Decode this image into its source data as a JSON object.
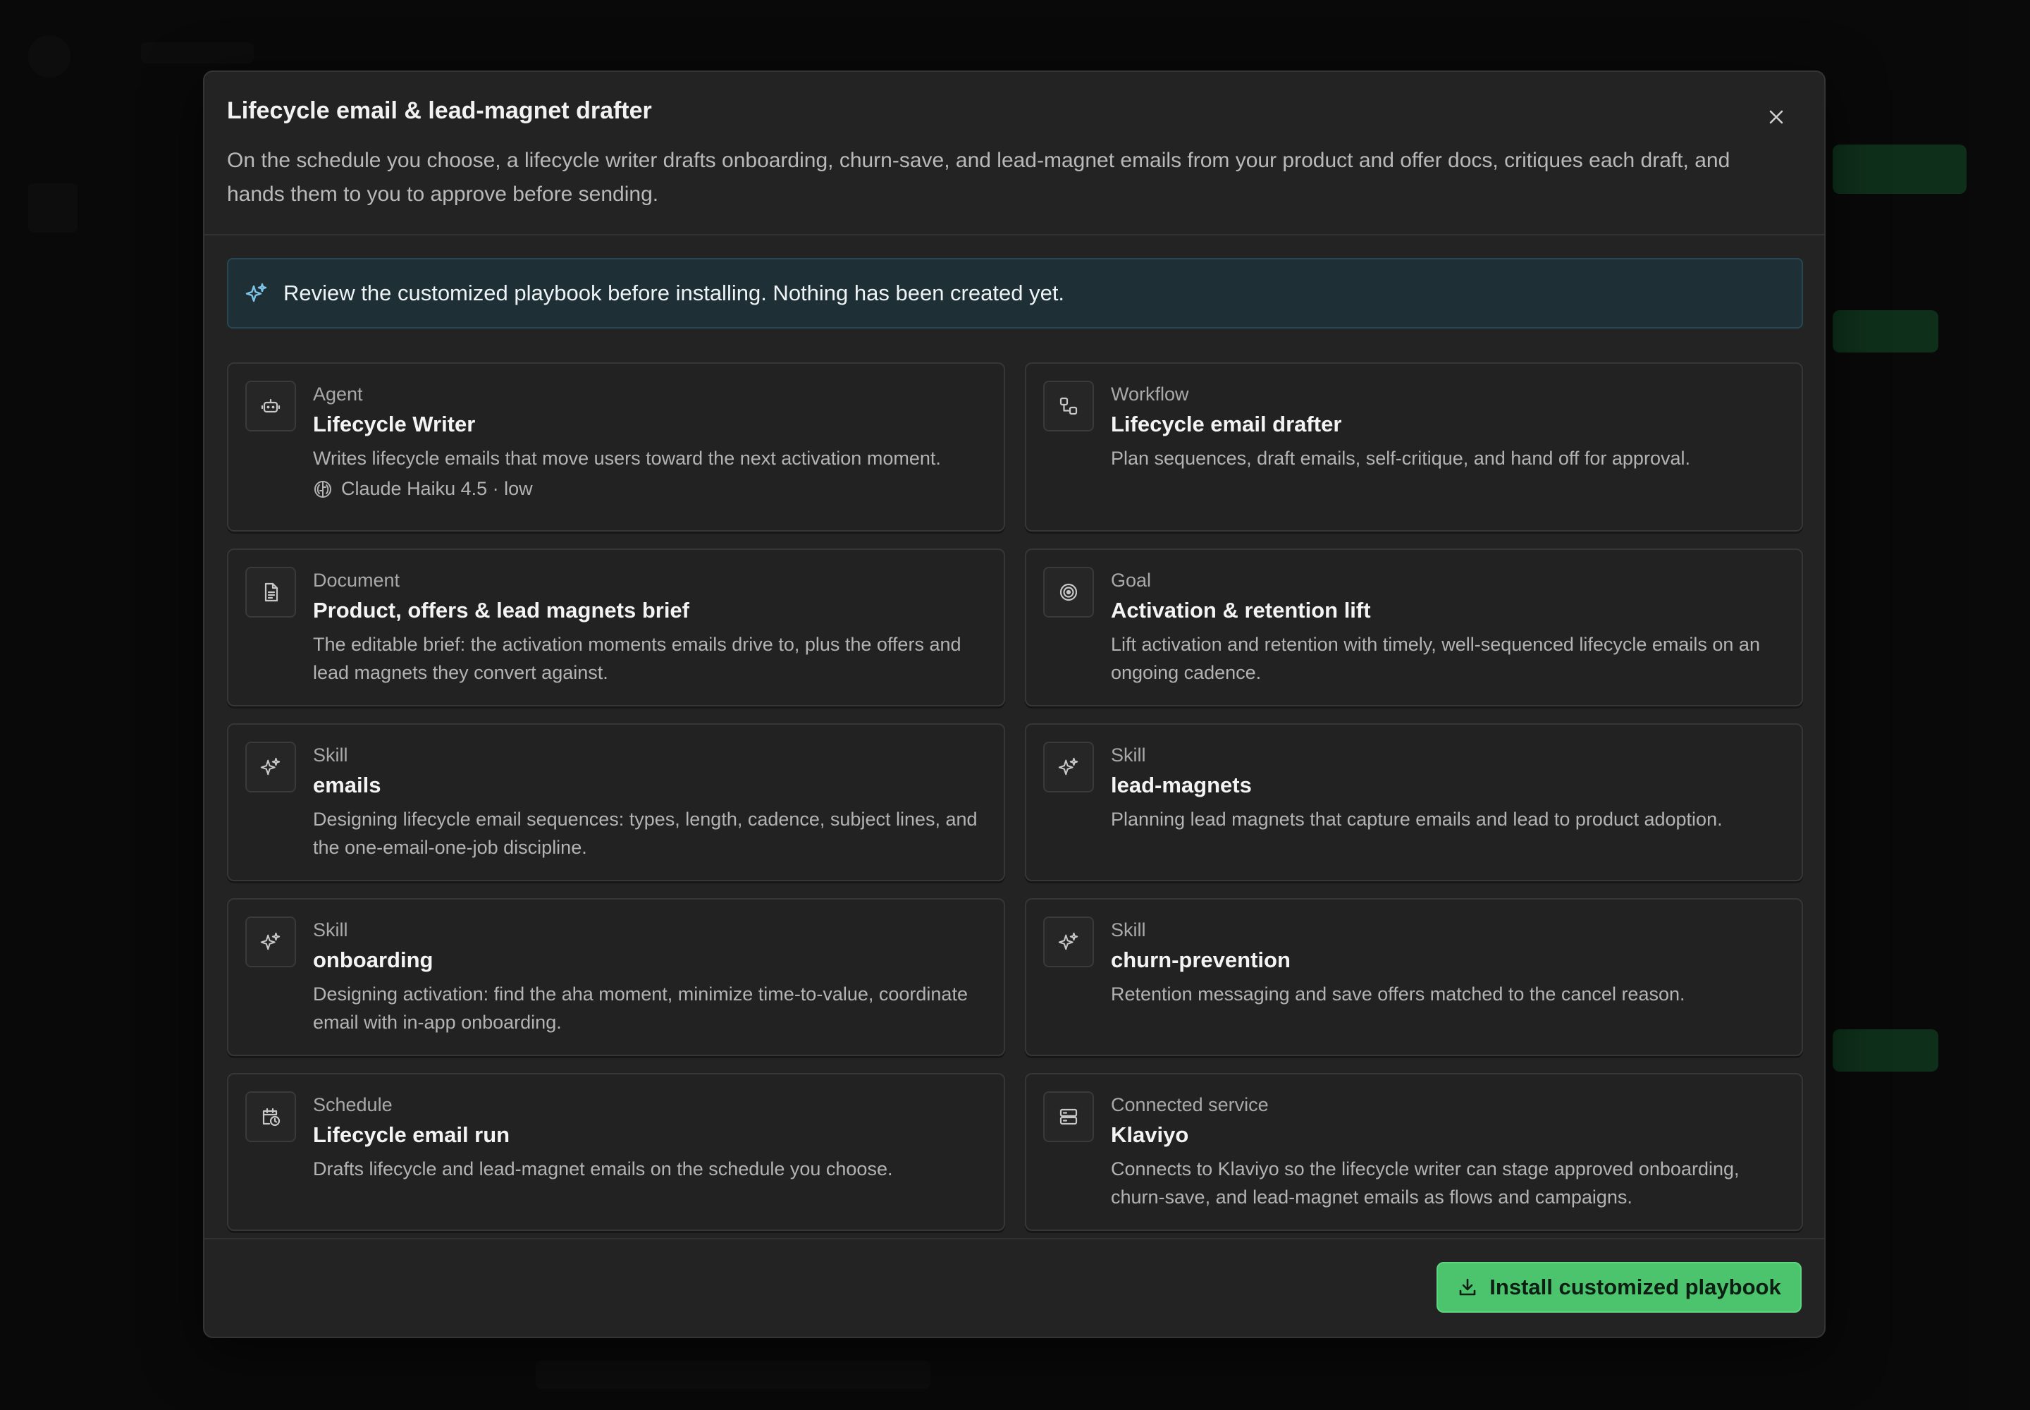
{
  "modal": {
    "title": "Lifecycle email & lead-magnet drafter",
    "description": "On the schedule you choose, a lifecycle writer drafts onboarding, churn-save, and lead-magnet emails from your product and offer docs, critiques each draft, and hands them to you to approve before sending.",
    "close_icon": "close-icon"
  },
  "banner": {
    "icon": "sparkle-icon",
    "text": "Review the customized playbook before installing. Nothing has been created yet."
  },
  "cards": [
    {
      "kind": "Agent",
      "title": "Lifecycle Writer",
      "description": "Writes lifecycle emails that move users toward the next activation moment.",
      "icon": "robot-icon",
      "model": "Claude Haiku 4.5 · low",
      "model_icon": "brain-icon"
    },
    {
      "kind": "Workflow",
      "title": "Lifecycle email drafter",
      "description": "Plan sequences, draft emails, self-critique, and hand off for approval.",
      "icon": "workflow-icon"
    },
    {
      "kind": "Document",
      "title": "Product, offers & lead magnets brief",
      "description": "The editable brief: the activation moments emails drive to, plus the offers and lead magnets they convert against.",
      "icon": "document-icon"
    },
    {
      "kind": "Goal",
      "title": "Activation & retention lift",
      "description": "Lift activation and retention with timely, well-sequenced lifecycle emails on an ongoing cadence.",
      "icon": "target-icon"
    },
    {
      "kind": "Skill",
      "title": "emails",
      "description": "Designing lifecycle email sequences: types, length, cadence, subject lines, and the one-email-one-job discipline.",
      "icon": "sparkle-icon"
    },
    {
      "kind": "Skill",
      "title": "lead-magnets",
      "description": "Planning lead magnets that capture emails and lead to product adoption.",
      "icon": "sparkle-icon"
    },
    {
      "kind": "Skill",
      "title": "onboarding",
      "description": "Designing activation: find the aha moment, minimize time-to-value, coordinate email with in-app onboarding.",
      "icon": "sparkle-icon"
    },
    {
      "kind": "Skill",
      "title": "churn-prevention",
      "description": "Retention messaging and save offers matched to the cancel reason.",
      "icon": "sparkle-icon"
    },
    {
      "kind": "Schedule",
      "title": "Lifecycle email run",
      "description": "Drafts lifecycle and lead-magnet emails on the schedule you choose.",
      "icon": "calendar-clock-icon"
    },
    {
      "kind": "Connected service",
      "title": "Klaviyo",
      "description": "Connects to Klaviyo so the lifecycle writer can stage approved onboarding, churn-save, and lead-magnet emails as flows and campaigns.",
      "icon": "server-icon"
    }
  ],
  "footer": {
    "install_label": "Install customized playbook",
    "install_icon": "download-icon"
  },
  "colors": {
    "accent_green": "#4cc46e",
    "banner_bg": "#1e2f36",
    "banner_icon": "#7cc4e8"
  }
}
